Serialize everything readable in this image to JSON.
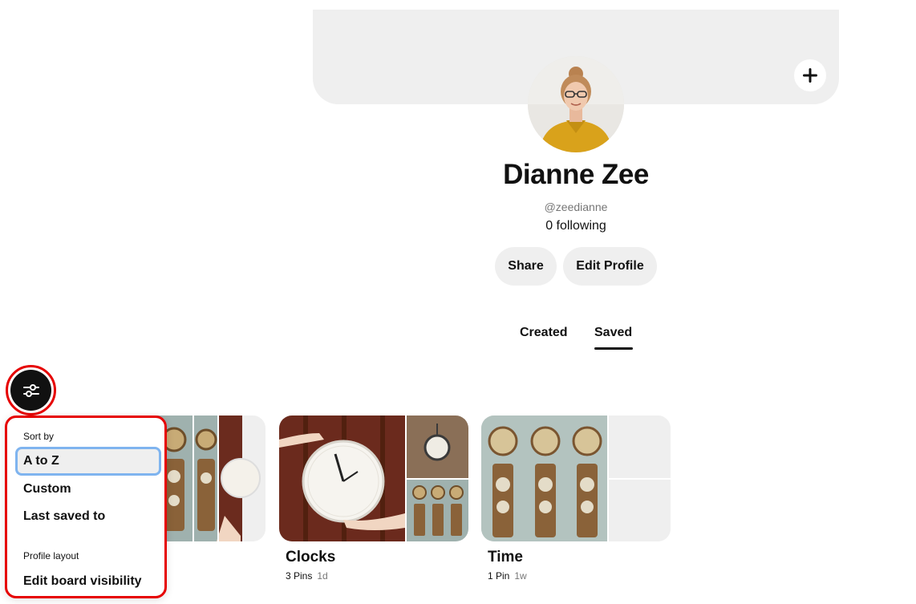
{
  "profile": {
    "name": "Dianne Zee",
    "handle": "@zeedianne",
    "following": "0 following",
    "share_label": "Share",
    "edit_profile_label": "Edit Profile",
    "cover_add_icon": "plus-icon"
  },
  "tabs": [
    {
      "label": "Created",
      "active": false
    },
    {
      "label": "Saved",
      "active": true
    }
  ],
  "filter_button": {
    "icon": "sliders-icon"
  },
  "sort_menu": {
    "sort_by_label": "Sort by",
    "items": [
      {
        "label": "A to Z",
        "selected": true
      },
      {
        "label": "Custom",
        "selected": false
      },
      {
        "label": "Last saved to",
        "selected": false
      }
    ],
    "profile_layout_label": "Profile layout",
    "edit_visibility_label": "Edit board visibility"
  },
  "boards": [
    {
      "title": "Clocks",
      "pins": "3 Pins",
      "age": "1d"
    },
    {
      "title": "Time",
      "pins": "1 Pin",
      "age": "1w"
    }
  ],
  "colors": {
    "accent_highlight": "#e60000",
    "selection_outline": "#7fb4ef",
    "pill_background": "#efefef"
  }
}
